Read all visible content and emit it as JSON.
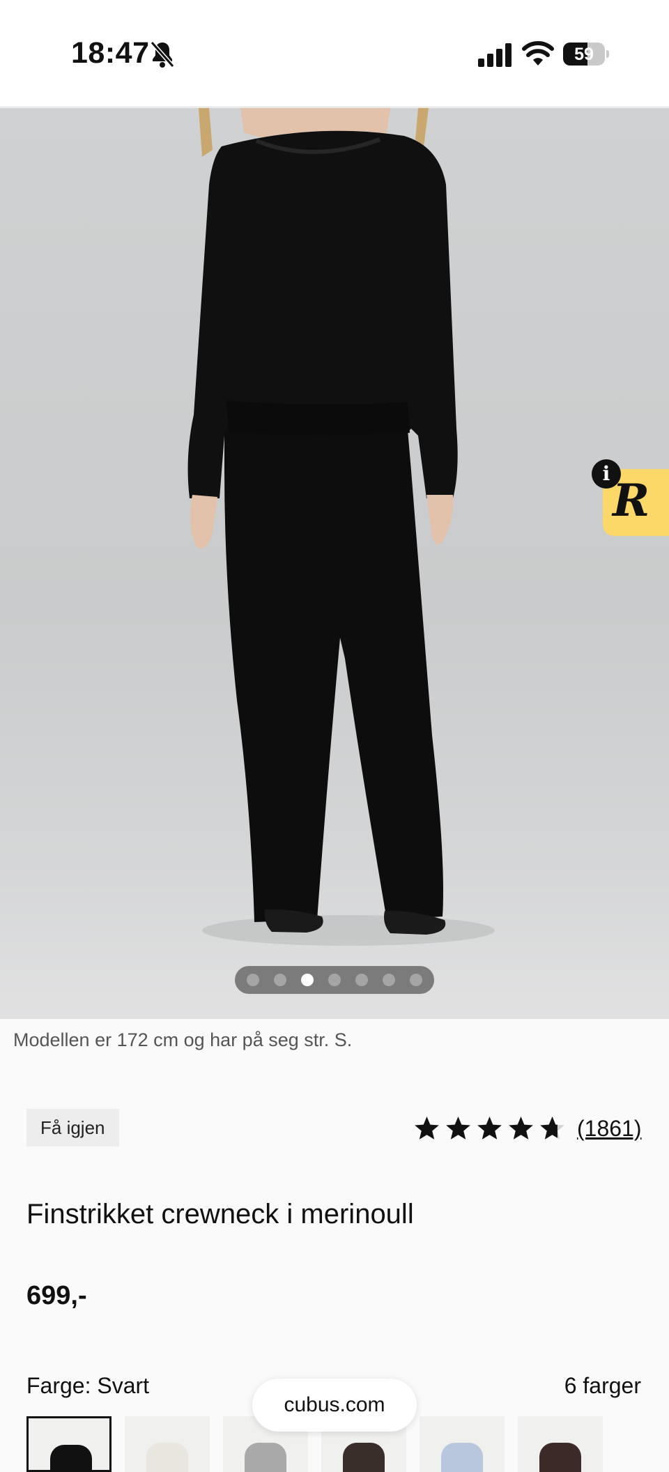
{
  "status_bar": {
    "time": "18:47",
    "battery": "59",
    "icons": [
      "bell-slash-icon",
      "signal-icon",
      "wifi-icon",
      "battery-icon"
    ]
  },
  "gallery": {
    "image_count": 7,
    "active_index": 2,
    "badge_icon": "r-logo-icon",
    "info_icon": "info-icon"
  },
  "caption": "Modellen er 172 cm og har på seg str. S.",
  "product": {
    "tag": "Få igjen",
    "rating": 4.7,
    "rating_max": 5,
    "review_count": "(1861)",
    "title": "Finstrikket crewneck i merinoull",
    "price": "699,-"
  },
  "colors": {
    "label": "Farge: Svart",
    "count": "6 farger",
    "swatches": [
      {
        "color": "#111111",
        "selected": true
      },
      {
        "color": "#e9e6df",
        "selected": false
      },
      {
        "color": "#a9a9a9",
        "selected": false
      },
      {
        "color": "#3a2e2a",
        "selected": false
      },
      {
        "color": "#b9c7de",
        "selected": false
      },
      {
        "color": "#3b2a28",
        "selected": false
      }
    ]
  },
  "browser": {
    "url": "cubus.com"
  }
}
